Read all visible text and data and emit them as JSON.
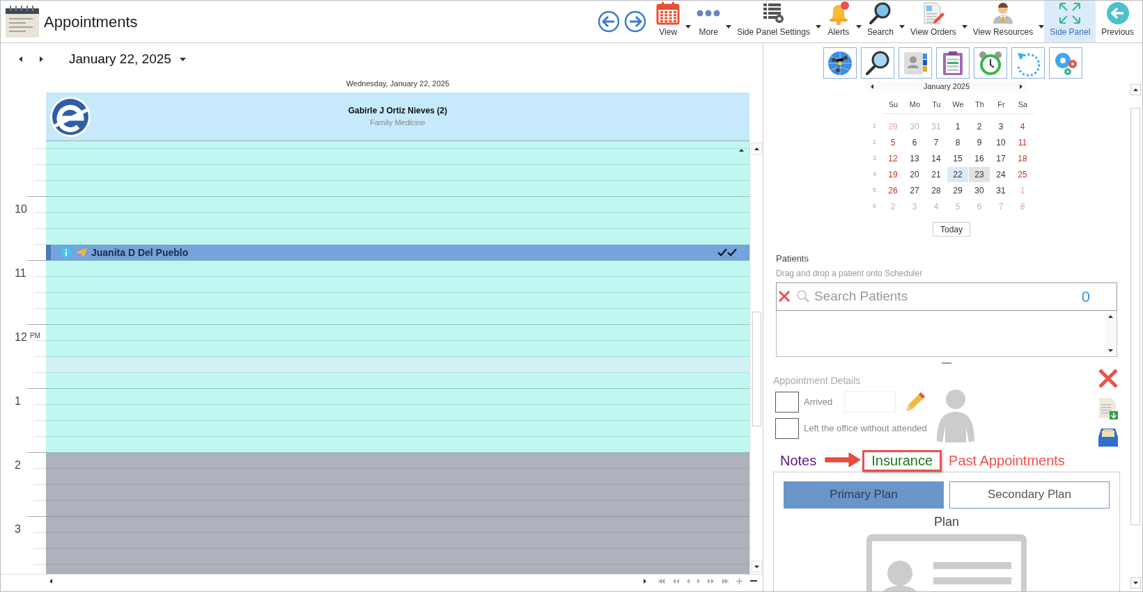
{
  "window": {
    "title": "Appointments"
  },
  "toolbar": {
    "nav": [
      {
        "kind": "back"
      },
      {
        "kind": "forward"
      }
    ],
    "items": [
      {
        "label": "View",
        "kind": "calendar",
        "dropdown": true,
        "selected": false
      },
      {
        "label": "More",
        "kind": "dots",
        "dropdown": true,
        "selected": false
      },
      {
        "label": "Side Panel Settings",
        "kind": "list-gear",
        "dropdown": true,
        "selected": false
      },
      {
        "label": "Alerts",
        "kind": "bell",
        "dropdown": true,
        "selected": false
      },
      {
        "label": "Search",
        "kind": "magnifier",
        "dropdown": true,
        "selected": false
      },
      {
        "label": "View Orders",
        "kind": "document-pencil",
        "dropdown": true,
        "selected": false
      },
      {
        "label": "View Resources",
        "kind": "person",
        "dropdown": true,
        "selected": false
      },
      {
        "label": "Side Panel",
        "kind": "expand",
        "dropdown": false,
        "selected": true
      },
      {
        "label": "Previous",
        "kind": "circle-back",
        "dropdown": false,
        "selected": false
      }
    ]
  },
  "scheduler": {
    "date": "January 22, 2025",
    "day_header": "Wednesday, January 22, 2025",
    "resource": {
      "name": "Gabirle J Ortiz Nieves (2)",
      "specialty": "Family Medicine"
    },
    "hours": [
      {
        "slots": [
          {
            "kind": "open"
          },
          {
            "kind": "open"
          },
          {
            "kind": "open"
          },
          {
            "kind": "open"
          }
        ]
      },
      {
        "label": "10",
        "slots": [
          {
            "kind": "open"
          },
          {
            "kind": "open"
          },
          {
            "kind": "open"
          },
          {
            "kind": "open",
            "appointment": {
              "patient": "Juanita D Del Pueblo"
            }
          }
        ]
      },
      {
        "label": "11",
        "slots": [
          {
            "kind": "open"
          },
          {
            "kind": "open"
          },
          {
            "kind": "open"
          },
          {
            "kind": "open"
          }
        ]
      },
      {
        "label": "12",
        "suffix": "PM",
        "slots": [
          {
            "kind": "open"
          },
          {
            "kind": "open"
          },
          {
            "kind": "highlight"
          },
          {
            "kind": "open"
          }
        ]
      },
      {
        "label": "1",
        "slots": [
          {
            "kind": "open"
          },
          {
            "kind": "open"
          },
          {
            "kind": "open"
          },
          {
            "kind": "open"
          }
        ]
      },
      {
        "label": "2",
        "slots": [
          {
            "kind": "off"
          },
          {
            "kind": "off"
          },
          {
            "kind": "off"
          },
          {
            "kind": "off"
          }
        ]
      },
      {
        "label": "3",
        "slots": [
          {
            "kind": "off"
          },
          {
            "kind": "off"
          },
          {
            "kind": "off"
          },
          {
            "kind": "off"
          }
        ]
      }
    ]
  },
  "side_panel": {
    "tools": [
      {
        "kind": "globe"
      },
      {
        "kind": "magnifier"
      },
      {
        "kind": "contacts"
      },
      {
        "kind": "clipboard"
      },
      {
        "kind": "alarm"
      },
      {
        "kind": "refresh"
      },
      {
        "kind": "gears"
      }
    ],
    "calendar": {
      "month": "January 2025",
      "weekdays": [
        "Su",
        "Mo",
        "Tu",
        "We",
        "Th",
        "Fr",
        "Sa"
      ],
      "weeks": [
        {
          "number": "1",
          "days": [
            {
              "label": "29",
              "kind": "other-weekend",
              "selected": false,
              "today": false
            },
            {
              "label": "30",
              "kind": "other",
              "selected": false,
              "today": false
            },
            {
              "label": "31",
              "kind": "other",
              "selected": false,
              "today": false
            },
            {
              "label": "1",
              "kind": "day",
              "selected": false,
              "today": false
            },
            {
              "label": "2",
              "kind": "day",
              "selected": false,
              "today": false
            },
            {
              "label": "3",
              "kind": "day",
              "selected": false,
              "today": false
            },
            {
              "label": "4",
              "kind": "weekend",
              "selected": false,
              "today": false
            }
          ]
        },
        {
          "number": "2",
          "days": [
            {
              "label": "5",
              "kind": "weekend",
              "selected": false,
              "today": false
            },
            {
              "label": "6",
              "kind": "day",
              "selected": false,
              "today": false
            },
            {
              "label": "7",
              "kind": "day",
              "selected": false,
              "today": false
            },
            {
              "label": "8",
              "kind": "day",
              "selected": false,
              "today": false
            },
            {
              "label": "9",
              "kind": "day",
              "selected": false,
              "today": false
            },
            {
              "label": "10",
              "kind": "day",
              "selected": false,
              "today": false
            },
            {
              "label": "11",
              "kind": "weekend",
              "selected": false,
              "today": false
            }
          ]
        },
        {
          "number": "3",
          "days": [
            {
              "label": "12",
              "kind": "weekend",
              "selected": false,
              "today": false
            },
            {
              "label": "13",
              "kind": "day",
              "selected": false,
              "today": false
            },
            {
              "label": "14",
              "kind": "day",
              "selected": false,
              "today": false
            },
            {
              "label": "15",
              "kind": "day",
              "selected": false,
              "today": false
            },
            {
              "label": "16",
              "kind": "day",
              "selected": false,
              "today": false
            },
            {
              "label": "17",
              "kind": "day",
              "selected": false,
              "today": false
            },
            {
              "label": "18",
              "kind": "weekend",
              "selected": false,
              "today": false
            }
          ]
        },
        {
          "number": "4",
          "days": [
            {
              "label": "19",
              "kind": "weekend",
              "selected": false,
              "today": false
            },
            {
              "label": "20",
              "kind": "day",
              "selected": false,
              "today": false
            },
            {
              "label": "21",
              "kind": "day",
              "selected": false,
              "today": false
            },
            {
              "label": "22",
              "kind": "day",
              "selected": true,
              "today": false
            },
            {
              "label": "23",
              "kind": "day",
              "selected": false,
              "today": true
            },
            {
              "label": "24",
              "kind": "day",
              "selected": false,
              "today": false
            },
            {
              "label": "25",
              "kind": "weekend",
              "selected": false,
              "today": false
            }
          ]
        },
        {
          "number": "5",
          "days": [
            {
              "label": "26",
              "kind": "weekend",
              "selected": false,
              "today": false
            },
            {
              "label": "27",
              "kind": "day",
              "selected": false,
              "today": false
            },
            {
              "label": "28",
              "kind": "day",
              "selected": false,
              "today": false
            },
            {
              "label": "29",
              "kind": "day",
              "selected": false,
              "today": false
            },
            {
              "label": "30",
              "kind": "day",
              "selected": false,
              "today": false
            },
            {
              "label": "31",
              "kind": "day",
              "selected": false,
              "today": false
            },
            {
              "label": "1",
              "kind": "other-weekend",
              "selected": false,
              "today": false
            }
          ]
        },
        {
          "number": "6",
          "days": [
            {
              "label": "2",
              "kind": "other-weekend",
              "selected": false,
              "today": false
            },
            {
              "label": "3",
              "kind": "other",
              "selected": false,
              "today": false
            },
            {
              "label": "4",
              "kind": "other",
              "selected": false,
              "today": false
            },
            {
              "label": "5",
              "kind": "other",
              "selected": false,
              "today": false
            },
            {
              "label": "6",
              "kind": "other",
              "selected": false,
              "today": false
            },
            {
              "label": "7",
              "kind": "other",
              "selected": false,
              "today": false
            },
            {
              "label": "8",
              "kind": "other-weekend",
              "selected": false,
              "today": false
            }
          ]
        }
      ],
      "today_button": "Today"
    },
    "patients": {
      "title": "Patients",
      "hint": "Drag and drop a patient onto Scheduler",
      "search": {
        "placeholder": "Search Patients"
      },
      "count": "0"
    },
    "appointment_details": {
      "title": "Appointment Details",
      "checks": [
        {
          "label": "Arrived",
          "checked": false,
          "kind": "with-field"
        },
        {
          "label": "Left the office without attended",
          "checked": false,
          "kind": "plain"
        }
      ]
    },
    "tabs": [
      {
        "label": "Notes",
        "color": "#5a1184",
        "selected": false,
        "pointer": false
      },
      {
        "label": "Insurance",
        "color": "#187a18",
        "selected": true,
        "pointer": true
      },
      {
        "label": "Past Appointments",
        "color": "#f05048",
        "selected": false,
        "pointer": false
      }
    ],
    "insurance": {
      "plans": [
        {
          "label": "Primary Plan",
          "selected": true
        },
        {
          "label": "Secondary Plan",
          "selected": false
        }
      ],
      "heading": "Plan"
    }
  }
}
